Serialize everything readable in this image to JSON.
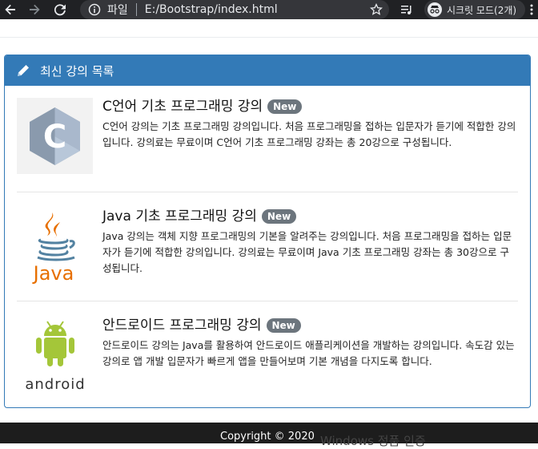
{
  "browser": {
    "scheme_label": "파일",
    "url": "E:/Bootstrap/index.html",
    "incognito_label": "시크릿 모드(2개)"
  },
  "panel": {
    "title": "최신 강의 목록",
    "items": [
      {
        "title": "C언어 기초 프로그래밍 강의",
        "badge": "New",
        "description": "C언어 강의는 기초 프로그래밍 강의입니다. 처음 프로그래밍을 접하는 입문자가 듣기에 적합한 강의입니다. 강의료는 무료이며 C언어 기초 프로그래밍 강좌는 총 20강으로 구성됩니다.",
        "icon": "c-language-logo"
      },
      {
        "title": "Java 기초 프로그래밍 강의",
        "badge": "New",
        "description": "Java 강의는 객체 지향 프로그래밍의 기본을 알려주는 강의입니다. 처음 프로그래밍을 접하는 입문자가 듣기에 적합한 강의입니다. 강의료는 무료이며 Java 기초 프로그래밍 강좌는 총 30강으로 구성됩니다.",
        "icon": "java-logo",
        "logo_text": "Java"
      },
      {
        "title": "안드로이드 프로그래밍 강의",
        "badge": "New",
        "description": "안드로이드 강의는 Java를 활용하여 안드로이드 애플리케이션을 개발하는 강의입니다. 속도감 있는 강의로 앱 개발 입문자가 빠르게 앱을 만들어보며 기본 개념을 다지도록 합니다.",
        "icon": "android-logo",
        "logo_text": "android"
      }
    ]
  },
  "footer": {
    "copyright": "Copyright © 2020",
    "ghost_text": "Windows 정품 인증"
  },
  "colors": {
    "primary": "#337ab7",
    "badge": "#6c757d",
    "footer": "#1d1d1d"
  }
}
